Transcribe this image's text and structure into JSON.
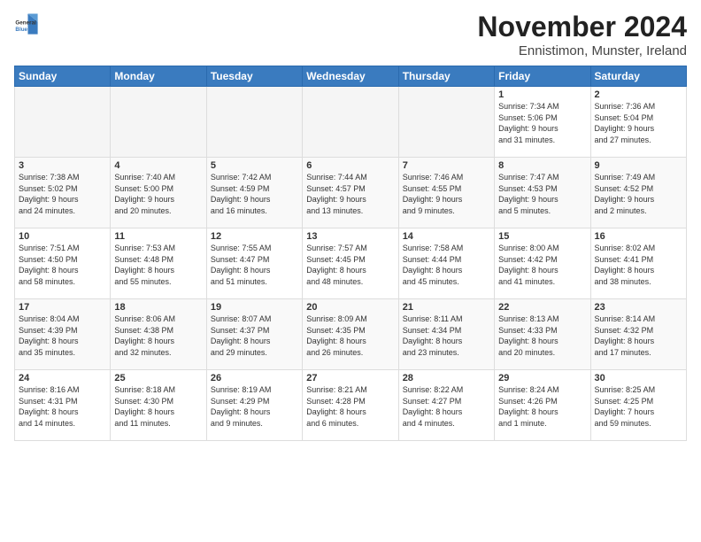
{
  "logo": {
    "general": "General",
    "blue": "Blue"
  },
  "title": "November 2024",
  "subtitle": "Ennistimon, Munster, Ireland",
  "weekdays": [
    "Sunday",
    "Monday",
    "Tuesday",
    "Wednesday",
    "Thursday",
    "Friday",
    "Saturday"
  ],
  "weeks": [
    [
      {
        "day": "",
        "info": ""
      },
      {
        "day": "",
        "info": ""
      },
      {
        "day": "",
        "info": ""
      },
      {
        "day": "",
        "info": ""
      },
      {
        "day": "",
        "info": ""
      },
      {
        "day": "1",
        "info": "Sunrise: 7:34 AM\nSunset: 5:06 PM\nDaylight: 9 hours\nand 31 minutes."
      },
      {
        "day": "2",
        "info": "Sunrise: 7:36 AM\nSunset: 5:04 PM\nDaylight: 9 hours\nand 27 minutes."
      }
    ],
    [
      {
        "day": "3",
        "info": "Sunrise: 7:38 AM\nSunset: 5:02 PM\nDaylight: 9 hours\nand 24 minutes."
      },
      {
        "day": "4",
        "info": "Sunrise: 7:40 AM\nSunset: 5:00 PM\nDaylight: 9 hours\nand 20 minutes."
      },
      {
        "day": "5",
        "info": "Sunrise: 7:42 AM\nSunset: 4:59 PM\nDaylight: 9 hours\nand 16 minutes."
      },
      {
        "day": "6",
        "info": "Sunrise: 7:44 AM\nSunset: 4:57 PM\nDaylight: 9 hours\nand 13 minutes."
      },
      {
        "day": "7",
        "info": "Sunrise: 7:46 AM\nSunset: 4:55 PM\nDaylight: 9 hours\nand 9 minutes."
      },
      {
        "day": "8",
        "info": "Sunrise: 7:47 AM\nSunset: 4:53 PM\nDaylight: 9 hours\nand 5 minutes."
      },
      {
        "day": "9",
        "info": "Sunrise: 7:49 AM\nSunset: 4:52 PM\nDaylight: 9 hours\nand 2 minutes."
      }
    ],
    [
      {
        "day": "10",
        "info": "Sunrise: 7:51 AM\nSunset: 4:50 PM\nDaylight: 8 hours\nand 58 minutes."
      },
      {
        "day": "11",
        "info": "Sunrise: 7:53 AM\nSunset: 4:48 PM\nDaylight: 8 hours\nand 55 minutes."
      },
      {
        "day": "12",
        "info": "Sunrise: 7:55 AM\nSunset: 4:47 PM\nDaylight: 8 hours\nand 51 minutes."
      },
      {
        "day": "13",
        "info": "Sunrise: 7:57 AM\nSunset: 4:45 PM\nDaylight: 8 hours\nand 48 minutes."
      },
      {
        "day": "14",
        "info": "Sunrise: 7:58 AM\nSunset: 4:44 PM\nDaylight: 8 hours\nand 45 minutes."
      },
      {
        "day": "15",
        "info": "Sunrise: 8:00 AM\nSunset: 4:42 PM\nDaylight: 8 hours\nand 41 minutes."
      },
      {
        "day": "16",
        "info": "Sunrise: 8:02 AM\nSunset: 4:41 PM\nDaylight: 8 hours\nand 38 minutes."
      }
    ],
    [
      {
        "day": "17",
        "info": "Sunrise: 8:04 AM\nSunset: 4:39 PM\nDaylight: 8 hours\nand 35 minutes."
      },
      {
        "day": "18",
        "info": "Sunrise: 8:06 AM\nSunset: 4:38 PM\nDaylight: 8 hours\nand 32 minutes."
      },
      {
        "day": "19",
        "info": "Sunrise: 8:07 AM\nSunset: 4:37 PM\nDaylight: 8 hours\nand 29 minutes."
      },
      {
        "day": "20",
        "info": "Sunrise: 8:09 AM\nSunset: 4:35 PM\nDaylight: 8 hours\nand 26 minutes."
      },
      {
        "day": "21",
        "info": "Sunrise: 8:11 AM\nSunset: 4:34 PM\nDaylight: 8 hours\nand 23 minutes."
      },
      {
        "day": "22",
        "info": "Sunrise: 8:13 AM\nSunset: 4:33 PM\nDaylight: 8 hours\nand 20 minutes."
      },
      {
        "day": "23",
        "info": "Sunrise: 8:14 AM\nSunset: 4:32 PM\nDaylight: 8 hours\nand 17 minutes."
      }
    ],
    [
      {
        "day": "24",
        "info": "Sunrise: 8:16 AM\nSunset: 4:31 PM\nDaylight: 8 hours\nand 14 minutes."
      },
      {
        "day": "25",
        "info": "Sunrise: 8:18 AM\nSunset: 4:30 PM\nDaylight: 8 hours\nand 11 minutes."
      },
      {
        "day": "26",
        "info": "Sunrise: 8:19 AM\nSunset: 4:29 PM\nDaylight: 8 hours\nand 9 minutes."
      },
      {
        "day": "27",
        "info": "Sunrise: 8:21 AM\nSunset: 4:28 PM\nDaylight: 8 hours\nand 6 minutes."
      },
      {
        "day": "28",
        "info": "Sunrise: 8:22 AM\nSunset: 4:27 PM\nDaylight: 8 hours\nand 4 minutes."
      },
      {
        "day": "29",
        "info": "Sunrise: 8:24 AM\nSunset: 4:26 PM\nDaylight: 8 hours\nand 1 minute."
      },
      {
        "day": "30",
        "info": "Sunrise: 8:25 AM\nSunset: 4:25 PM\nDaylight: 7 hours\nand 59 minutes."
      }
    ]
  ]
}
